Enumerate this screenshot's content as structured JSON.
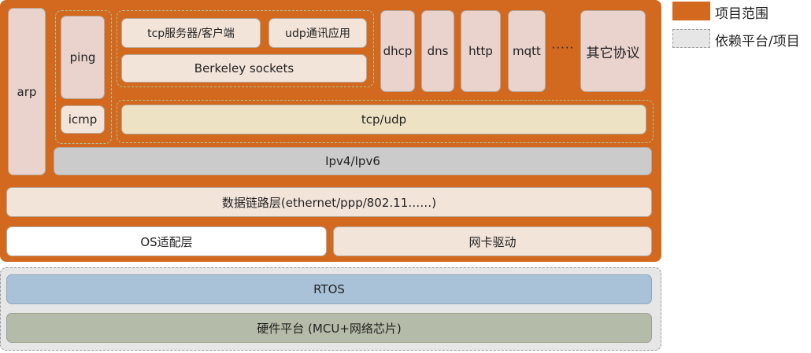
{
  "diagram": {
    "arp": "arp",
    "ping": "ping",
    "icmp": "icmp",
    "tcp_server_client": "tcp服务器/客户端",
    "udp_app": "udp通讯应用",
    "berkeley_sockets": "Berkeley sockets",
    "protocols": [
      "dhcp",
      "dns",
      "http",
      "mqtt"
    ],
    "ellipsis": "·····",
    "other_protocols": "其它协议",
    "tcp_udp": "tcp/udp",
    "ipv4_ipv6": "Ipv4/Ipv6",
    "datalink": "数据链路层(ethernet/ppp/802.11……)",
    "os_adapter": "OS适配层",
    "nic_driver": "网卡驱动",
    "rtos": "RTOS",
    "hardware": "硬件平台 (MCU+网络芯片)"
  },
  "legend": {
    "project_scope": "项目范围",
    "dependency": "依赖平台/项目"
  },
  "colors": {
    "project_scope": "#d2691e",
    "dependency": "#e6e6e6"
  }
}
